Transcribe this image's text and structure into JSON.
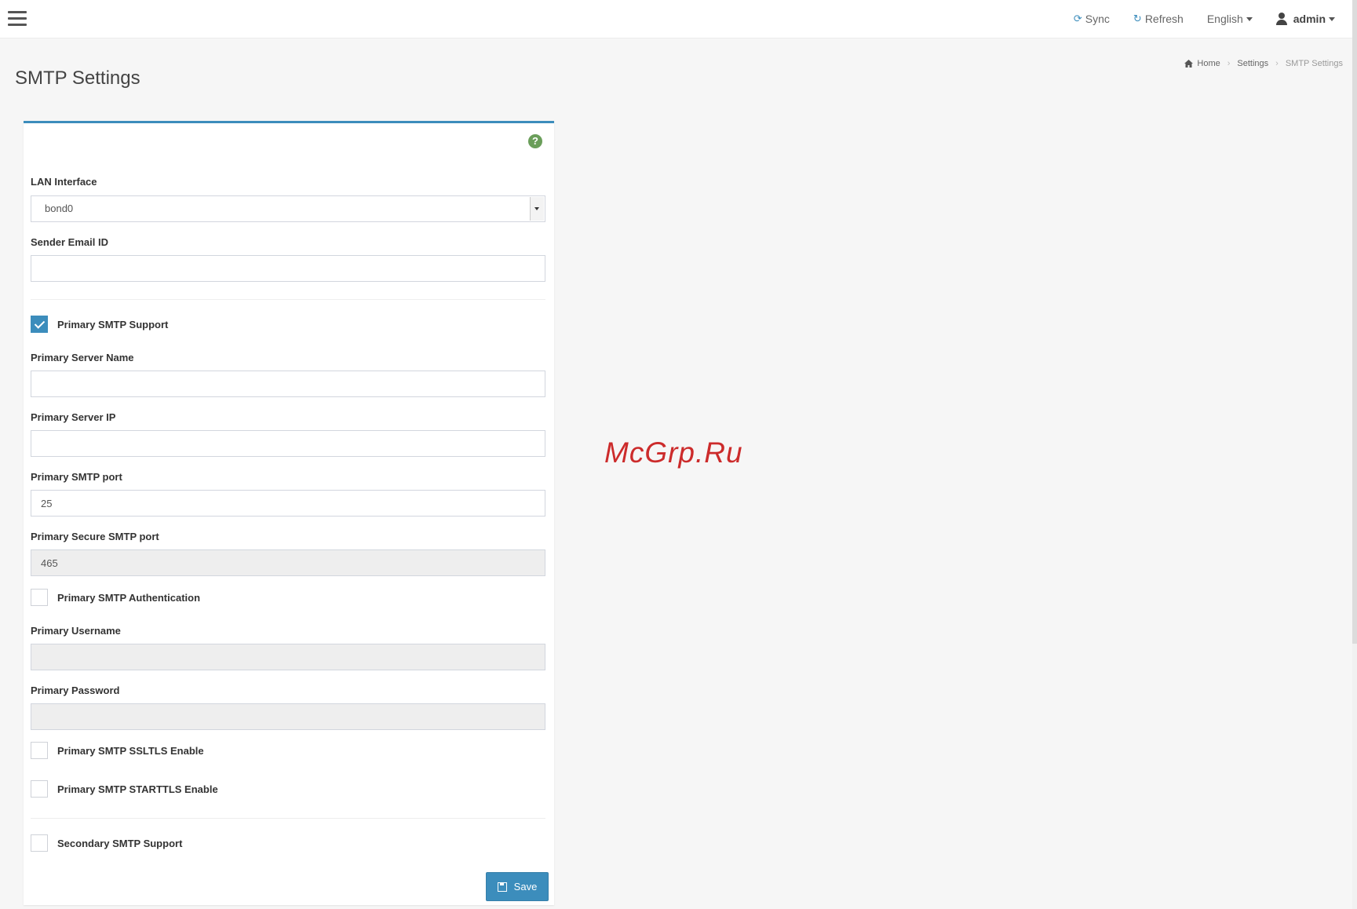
{
  "header": {
    "sync_label": "Sync",
    "refresh_label": "Refresh",
    "language_label": "English",
    "user_label": "admin"
  },
  "page": {
    "title": "SMTP Settings"
  },
  "breadcrumb": {
    "home": "Home",
    "settings": "Settings",
    "current": "SMTP Settings"
  },
  "watermark": "McGrp.Ru",
  "form": {
    "help_icon": "?",
    "lan_interface_label": "LAN Interface",
    "lan_interface_value": "bond0",
    "sender_email_label": "Sender Email ID",
    "sender_email_value": "",
    "primary_smtp_support_label": "Primary SMTP Support",
    "primary_smtp_support_checked": true,
    "primary_server_name_label": "Primary Server Name",
    "primary_server_name_value": "",
    "primary_server_ip_label": "Primary Server IP",
    "primary_server_ip_value": "",
    "primary_smtp_port_label": "Primary SMTP port",
    "primary_smtp_port_value": "25",
    "primary_secure_port_label": "Primary Secure SMTP port",
    "primary_secure_port_value": "465",
    "primary_auth_label": "Primary SMTP Authentication",
    "primary_username_label": "Primary Username",
    "primary_username_value": "",
    "primary_password_label": "Primary Password",
    "primary_password_value": "",
    "primary_ssltls_label": "Primary SMTP SSLTLS Enable",
    "primary_starttls_label": "Primary SMTP STARTTLS Enable",
    "secondary_support_label": "Secondary SMTP Support",
    "save_label": "Save"
  },
  "colors": {
    "accent": "#3c8dbc",
    "help": "#6a9e5a",
    "watermark": "#cc2b2b"
  }
}
